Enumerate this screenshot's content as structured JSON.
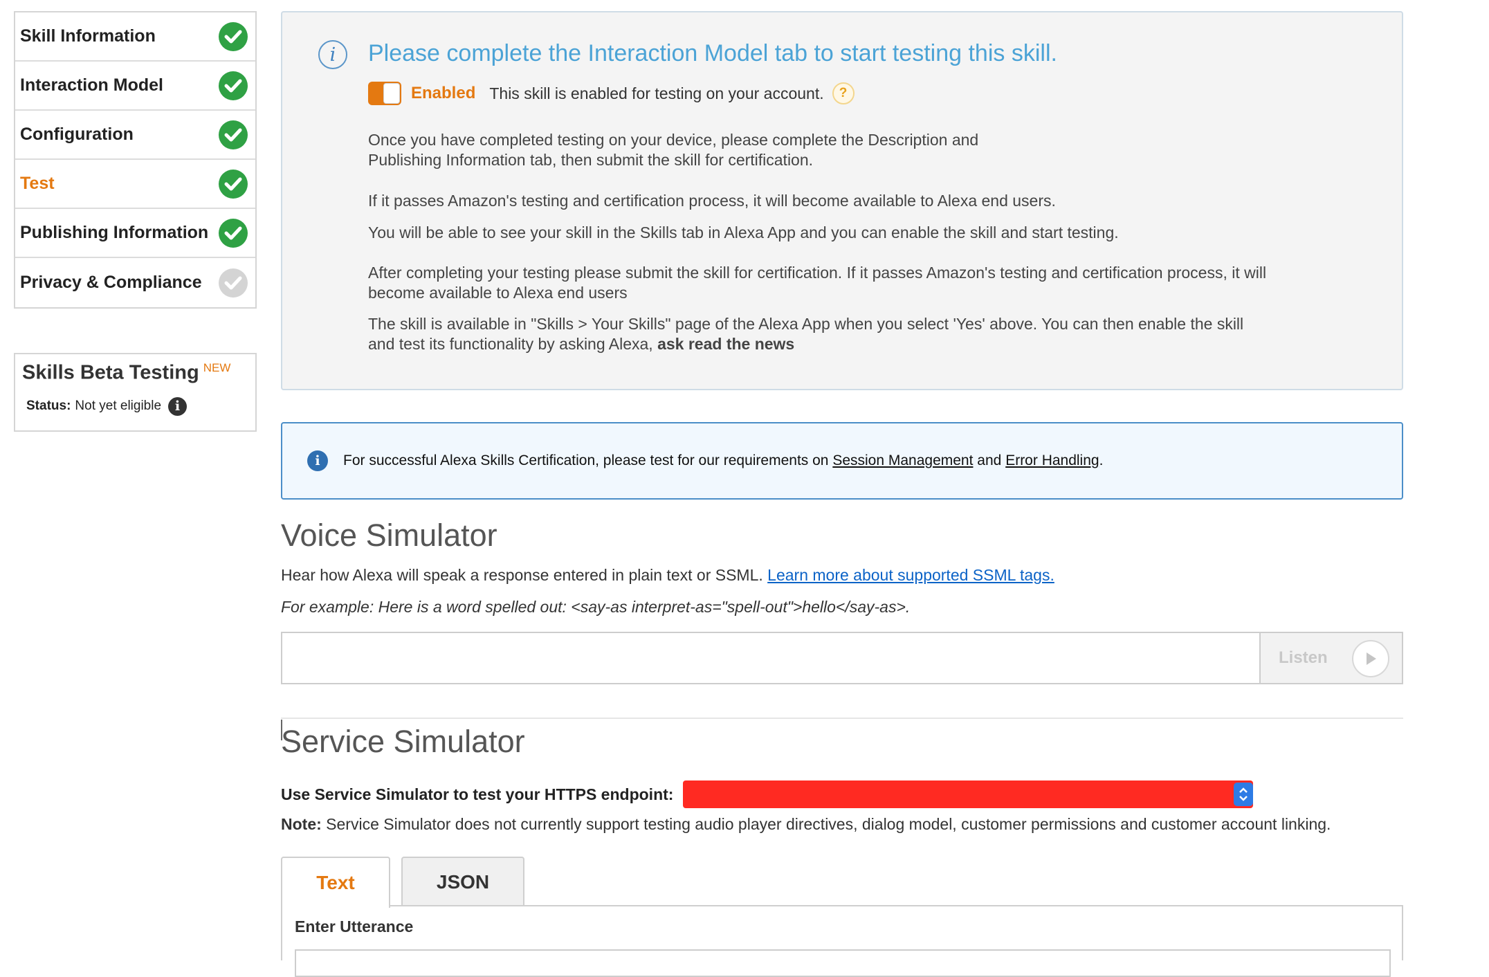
{
  "sidebar": {
    "items": [
      {
        "label": "Skill Information",
        "status": "complete"
      },
      {
        "label": "Interaction Model",
        "status": "complete"
      },
      {
        "label": "Configuration",
        "status": "complete"
      },
      {
        "label": "Test",
        "status": "complete",
        "active": true
      },
      {
        "label": "Publishing Information",
        "status": "complete"
      },
      {
        "label": "Privacy & Compliance",
        "status": "pending"
      }
    ]
  },
  "beta": {
    "title": "Skills Beta Testing",
    "badge": "NEW",
    "status_label": "Status:",
    "status_value": "Not yet eligible"
  },
  "notice": {
    "title": "Please complete the Interaction Model tab to start testing this skill.",
    "toggle_label": "Enabled",
    "toggle_desc": "This skill is enabled for testing on your account.",
    "help_glyph": "?",
    "p1_line1": "Once you have completed testing on your device, please complete the Description and",
    "p1_line2": "Publishing Information tab, then submit the skill for certification.",
    "p2": "If it passes Amazon's testing and certification process, it will become available to Alexa end users.",
    "p3": "You will be able to see your skill in the Skills tab in Alexa App and you can enable the skill and start testing.",
    "p4_line1": "After completing your testing please submit the skill for certification. If it passes Amazon's testing and certification process, it will",
    "p4_line2": "become available to Alexa end users",
    "p5_line1": "The skill is available in \"Skills > Your Skills\" page of the Alexa App when you select 'Yes' above. You can then enable the skill",
    "p5_line2": "and test its functionality by asking Alexa,",
    "p5_bold": "ask read the news"
  },
  "cert": {
    "text_before": "For successful Alexa Skills Certification, please test for our requirements on",
    "link1": "Session Management",
    "text_mid": "and",
    "link2": "Error Handling",
    "text_after": "."
  },
  "voice": {
    "title": "Voice Simulator",
    "desc": "Hear how Alexa will speak a response entered in plain text or SSML.",
    "link": "Learn more about supported SSML tags.",
    "example": "For example: Here is a word spelled out: <say-as interpret-as=\"spell-out\">hello</say-as>.",
    "input_value": "",
    "listen_label": "Listen"
  },
  "service": {
    "title": "Service Simulator",
    "endpoint_label": "Use Service Simulator to test your HTTPS endpoint:",
    "endpoint_value": "",
    "note_label": "Note:",
    "note_text": "Service Simulator does not currently support testing audio player directives, dialog model, customer permissions and customer account linking.",
    "tabs": [
      {
        "label": "Text",
        "active": true
      },
      {
        "label": "JSON",
        "active": false
      }
    ],
    "utterance_label": "Enter Utterance",
    "utterance_value": ""
  },
  "colors": {
    "accent": "#e47911",
    "check_green": "#2fa144",
    "info_title": "#4ba3d6",
    "link_blue": "#0c63c7",
    "redaction": "#ff2a22"
  }
}
